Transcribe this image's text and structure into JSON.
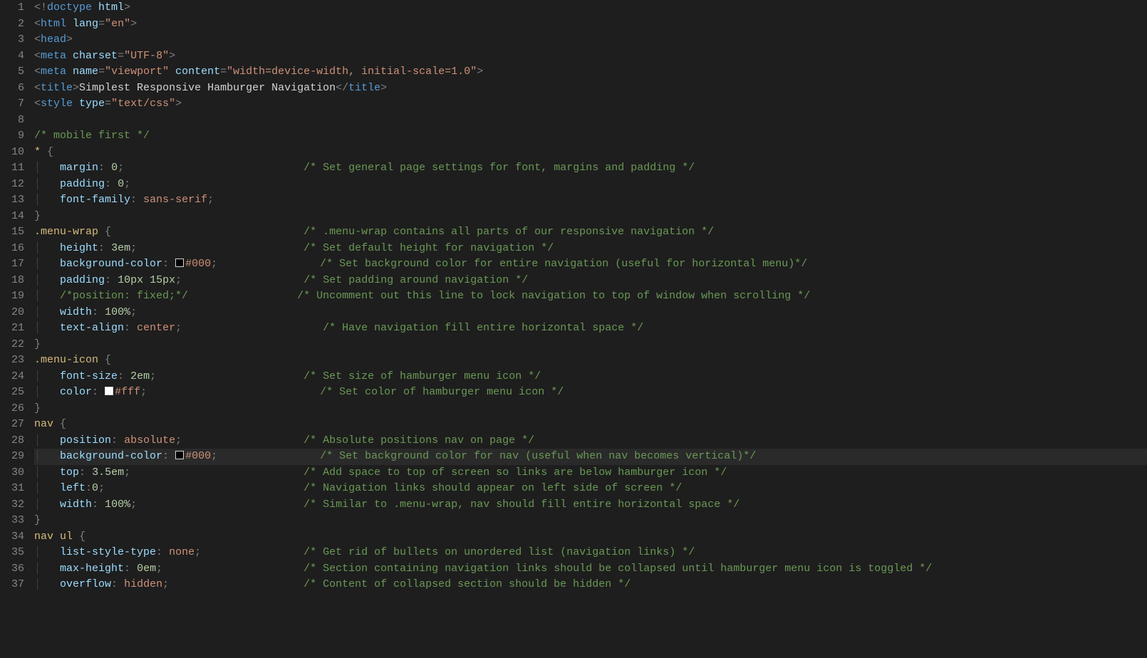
{
  "lineNumbers": [
    "1",
    "2",
    "3",
    "4",
    "5",
    "6",
    "7",
    "8",
    "9",
    "10",
    "11",
    "12",
    "13",
    "14",
    "15",
    "16",
    "17",
    "18",
    "19",
    "20",
    "21",
    "22",
    "23",
    "24",
    "25",
    "26",
    "27",
    "28",
    "29",
    "30",
    "31",
    "32",
    "33",
    "34",
    "35",
    "36",
    "37"
  ],
  "activeLine": 29,
  "code": {
    "l1": {
      "doctype": "doctype",
      "html": "html"
    },
    "l2": {
      "tag": "html",
      "attr": "lang",
      "val": "\"en\""
    },
    "l3": {
      "tag": "head"
    },
    "l4": {
      "tag": "meta",
      "attr": "charset",
      "val": "\"UTF-8\""
    },
    "l5": {
      "tag": "meta",
      "attr1": "name",
      "val1": "\"viewport\"",
      "attr2": "content",
      "val2": "\"width=device-width, initial-scale=1.0\""
    },
    "l6": {
      "tag": "title",
      "text": "Simplest Responsive Hamburger Navigation",
      "ctag": "title"
    },
    "l7": {
      "tag": "style",
      "attr": "type",
      "val": "\"text/css\""
    },
    "l9": {
      "comment": "/* mobile first */"
    },
    "l10": {
      "sel": "*"
    },
    "l11": {
      "prop": "margin",
      "val": "0",
      "comment": "/* Set general page settings for font, margins and padding */"
    },
    "l12": {
      "prop": "padding",
      "val": "0"
    },
    "l13": {
      "prop": "font-family",
      "val": "sans-serif"
    },
    "l15": {
      "sel": ".menu-wrap",
      "comment": "/* .menu-wrap contains all parts of our responsive navigation */"
    },
    "l16": {
      "prop": "height",
      "num": "3",
      "unit": "em",
      "comment": "/* Set default height for navigation */"
    },
    "l17": {
      "prop": "background-color",
      "hex": "#000",
      "comment": "/* Set background color for entire navigation (useful for horizontal menu)*/"
    },
    "l18": {
      "prop": "padding",
      "v1n": "10",
      "v1u": "px",
      "v2n": "15",
      "v2u": "px",
      "comment": "/* Set padding around navigation */"
    },
    "l19": {
      "comment1": "/*position: fixed;*/",
      "comment2": "/* Uncomment out this line to lock navigation to top of window when scrolling */"
    },
    "l20": {
      "prop": "width",
      "num": "100",
      "unit": "%"
    },
    "l21": {
      "prop": "text-align",
      "val": "center",
      "comment": "/* Have navigation fill entire horizontal space */"
    },
    "l23": {
      "sel": ".menu-icon"
    },
    "l24": {
      "prop": "font-size",
      "num": "2",
      "unit": "em",
      "comment": "/* Set size of hamburger menu icon */"
    },
    "l25": {
      "prop": "color",
      "hex": "#fff",
      "comment": "/* Set color of hamburger menu icon */"
    },
    "l27": {
      "sel": "nav"
    },
    "l28": {
      "prop": "position",
      "val": "absolute",
      "comment": "/* Absolute positions nav on page */"
    },
    "l29": {
      "prop": "background-color",
      "hex": "#000",
      "comment": "/* Set background color for nav (useful when nav becomes vertical)*/"
    },
    "l30": {
      "prop": "top",
      "num": "3.5",
      "unit": "em",
      "comment": "/* Add space to top of screen so links are below hamburger icon */"
    },
    "l31": {
      "prop": "left",
      "num": "0",
      "comment": "/* Navigation links should appear on left side of screen */"
    },
    "l32": {
      "prop": "width",
      "num": "100",
      "unit": "%",
      "comment": "/* Similar to .menu-wrap, nav should fill entire horizontal space */"
    },
    "l34": {
      "sel1": "nav",
      "sel2": "ul"
    },
    "l35": {
      "prop": "list-style-type",
      "val": "none",
      "comment": "/* Get rid of bullets on unordered list (navigation links) */"
    },
    "l36": {
      "prop": "max-height",
      "num": "0",
      "unit": "em",
      "comment": "/* Section containing navigation links should be collapsed until hamburger menu icon is toggled */"
    },
    "l37": {
      "prop": "overflow",
      "val": "hidden",
      "comment": "/* Content of collapsed section should be hidden */"
    }
  }
}
